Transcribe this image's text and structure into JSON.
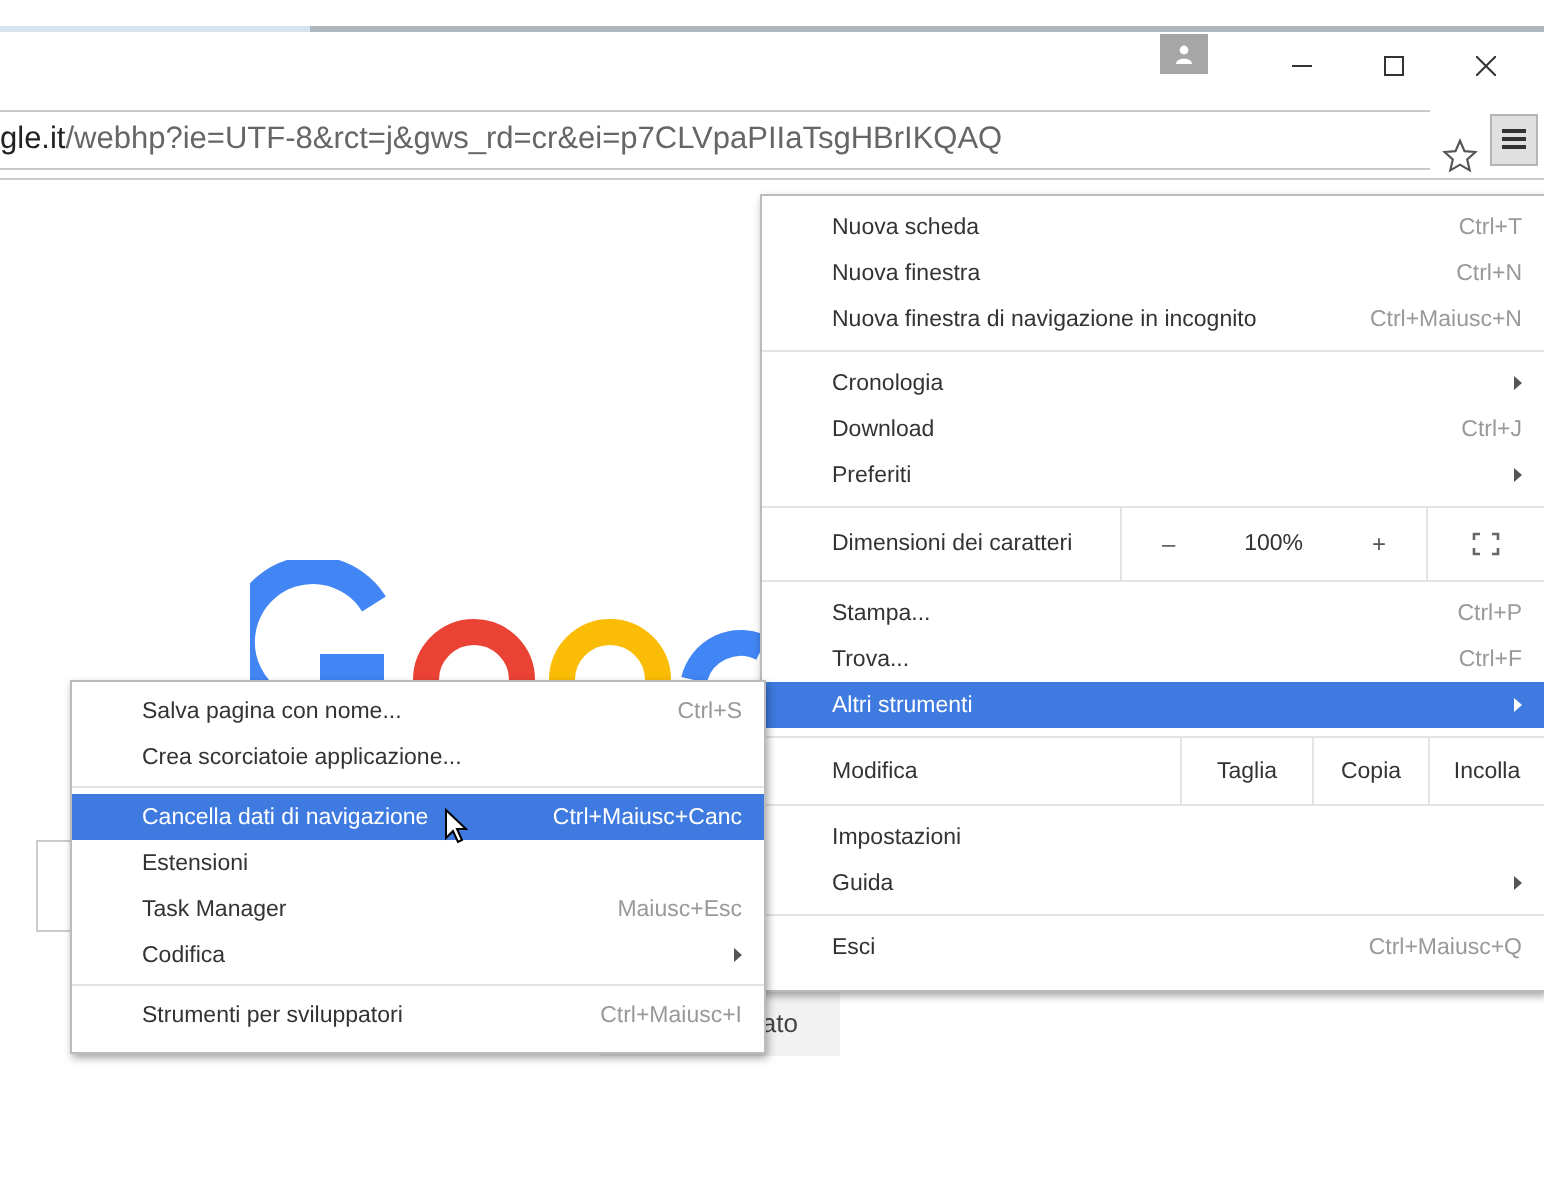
{
  "address_bar": {
    "domain": "gle.it",
    "path": "/webhp?ie=UTF-8&rct=j&gws_rd=cr&ei=p7CLVpaPIIaTsgHBrIKQAQ"
  },
  "page": {
    "button_fragment": "ato"
  },
  "main_menu": {
    "groups": [
      {
        "kind": "items",
        "items": [
          {
            "label": "Nuova scheda",
            "shortcut": "Ctrl+T",
            "submenu": false,
            "selected": false
          },
          {
            "label": "Nuova finestra",
            "shortcut": "Ctrl+N",
            "submenu": false,
            "selected": false
          },
          {
            "label": "Nuova finestra di navigazione in incognito",
            "shortcut": "Ctrl+Maiusc+N",
            "submenu": false,
            "selected": false
          }
        ]
      },
      {
        "kind": "items",
        "items": [
          {
            "label": "Cronologia",
            "submenu": true,
            "selected": false
          },
          {
            "label": "Download",
            "shortcut": "Ctrl+J",
            "submenu": false,
            "selected": false
          },
          {
            "label": "Preferiti",
            "submenu": true,
            "selected": false
          }
        ]
      },
      {
        "kind": "zoom",
        "label": "Dimensioni dei caratteri",
        "minus": "–",
        "value": "100%",
        "plus": "+"
      },
      {
        "kind": "items",
        "items": [
          {
            "label": "Stampa...",
            "shortcut": "Ctrl+P",
            "submenu": false,
            "selected": false
          },
          {
            "label": "Trova...",
            "shortcut": "Ctrl+F",
            "submenu": false,
            "selected": false
          },
          {
            "label": "Altri strumenti",
            "submenu": true,
            "selected": true
          }
        ]
      },
      {
        "kind": "edit",
        "label": "Modifica",
        "buttons": [
          "Taglia",
          "Copia",
          "Incolla"
        ]
      },
      {
        "kind": "items",
        "items": [
          {
            "label": "Impostazioni",
            "submenu": false,
            "selected": false
          },
          {
            "label": "Guida",
            "submenu": true,
            "selected": false
          }
        ]
      },
      {
        "kind": "items",
        "items": [
          {
            "label": "Esci",
            "shortcut": "Ctrl+Maiusc+Q",
            "submenu": false,
            "selected": false
          }
        ]
      }
    ]
  },
  "submenu": {
    "groups": [
      {
        "kind": "items",
        "items": [
          {
            "label": "Salva pagina con nome...",
            "shortcut": "Ctrl+S",
            "submenu": false,
            "selected": false
          },
          {
            "label": "Crea scorciatoie applicazione...",
            "submenu": false,
            "selected": false
          }
        ]
      },
      {
        "kind": "items",
        "items": [
          {
            "label": "Cancella dati di navigazione",
            "shortcut": "Ctrl+Maiusc+Canc",
            "submenu": false,
            "selected": true
          },
          {
            "label": "Estensioni",
            "submenu": false,
            "selected": false
          },
          {
            "label": "Task Manager",
            "shortcut": "Maiusc+Esc",
            "submenu": false,
            "selected": false
          },
          {
            "label": "Codifica",
            "submenu": true,
            "selected": false
          }
        ]
      },
      {
        "kind": "items",
        "items": [
          {
            "label": "Strumenti per sviluppatori",
            "shortcut": "Ctrl+Maiusc+I",
            "submenu": false,
            "selected": false
          }
        ]
      }
    ]
  }
}
